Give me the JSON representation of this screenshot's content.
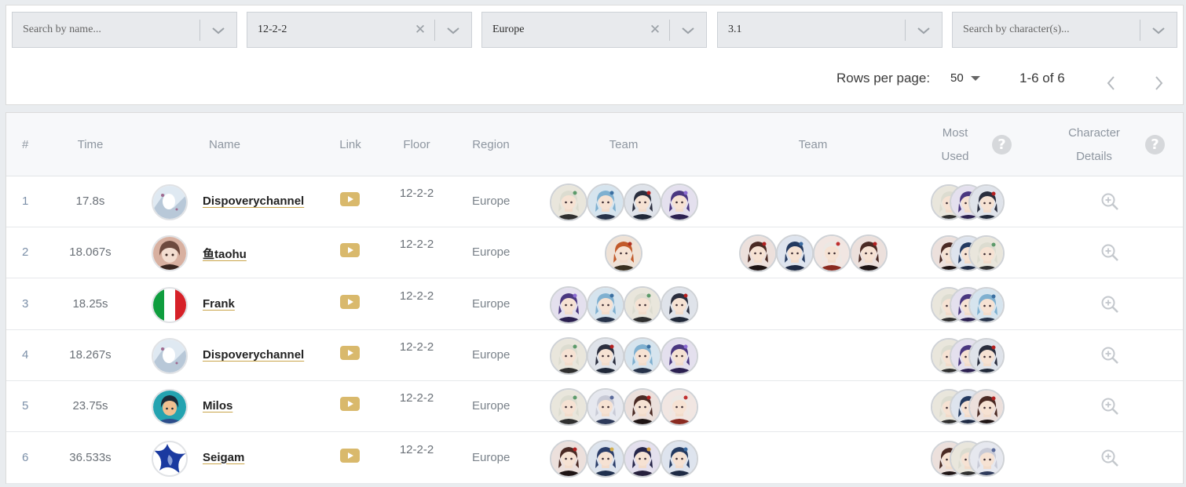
{
  "filters": [
    {
      "text": "Search by name...",
      "placeholder": true,
      "clearable": false
    },
    {
      "text": "12-2-2",
      "placeholder": false,
      "clearable": true
    },
    {
      "text": "Europe",
      "placeholder": false,
      "clearable": true
    },
    {
      "text": "3.1",
      "placeholder": false,
      "clearable": false
    },
    {
      "text": "Search by character(s)...",
      "placeholder": true,
      "clearable": false
    }
  ],
  "pagination": {
    "rows_per_page_label": "Rows per page:",
    "rows_per_page": "50",
    "range": "1-6 of 6"
  },
  "headers": {
    "rank": "#",
    "time": "Time",
    "name": "Name",
    "link": "Link",
    "floor": "Floor",
    "region": "Region",
    "team1": "Team",
    "team2": "Team",
    "most_used_1": "Most",
    "most_used_2": "Used",
    "details_1": "Character",
    "details_2": "Details"
  },
  "colors": {
    "accent_gold": "#c9a44a",
    "youtube": "#d9b96c",
    "header_bg": "#f7f8fa"
  },
  "characters": {
    "alhaitham": {
      "bg": "#e9e6dc",
      "hair": "#dcdcd0",
      "outfit": "#2f2f2f",
      "accent": "#5c9a6a"
    },
    "eula": {
      "bg": "#d6e4ee",
      "hair": "#7fb0d0",
      "outfit": "#27334a",
      "accent": "#3b6fa1"
    },
    "xiao": {
      "bg": "#dfe3ea",
      "hair": "#2a2e3e",
      "outfit": "#202838",
      "accent": "#b52020"
    },
    "raiden": {
      "bg": "#e4e0ee",
      "hair": "#4a3780",
      "outfit": "#2b2050",
      "accent": "#8a6ad0"
    },
    "tartaglia": {
      "bg": "#efe2d6",
      "hair": "#c25a2a",
      "outfit": "#3a3020",
      "accent": "#b03020"
    },
    "hutao": {
      "bg": "#ece0dc",
      "hair": "#4a2a24",
      "outfit": "#1e1414",
      "accent": "#b02020"
    },
    "yelan": {
      "bg": "#dee4ee",
      "hair": "#243a60",
      "outfit": "#1e2a44",
      "accent": "#3a6aa0"
    },
    "kazuha": {
      "bg": "#f1e6e2",
      "hair": "#ece8e4",
      "outfit": "#8a2a20",
      "accent": "#c03030"
    },
    "ayaka": {
      "bg": "#e6e8ef",
      "hair": "#c8cad6",
      "outfit": "#2e3a5a",
      "accent": "#5a6a9a"
    },
    "xingqiu": {
      "bg": "#dde4ee",
      "hair": "#2b3e6a",
      "outfit": "#20304e",
      "accent": "#d4b050"
    },
    "mona": {
      "bg": "#e4e0ee",
      "hair": "#27264a",
      "outfit": "#26203c",
      "accent": "#d4a040"
    }
  },
  "avatars": {
    "crystal": {
      "colors": [
        "#dfe9f2",
        "#b8c8d8",
        "#ffffff",
        "#a06a90"
      ]
    },
    "girl": {
      "colors": [
        "#6e4a3e",
        "#f3ddd0",
        "#3a2620",
        "#d8b0a0"
      ]
    },
    "italy": {
      "colors": [
        "#0f9d3e",
        "#ffffff",
        "#d62128"
      ]
    },
    "blueboy": {
      "colors": [
        "#24a3b0",
        "#1a2c3a",
        "#f0c090",
        "#2d4c8a"
      ]
    },
    "swirl": {
      "colors": [
        "#1a3aa0",
        "#ffffff",
        "#8aa0d8"
      ]
    }
  },
  "rows": [
    {
      "rank": "1",
      "time": "17.8s",
      "name": "Dispoverychannel",
      "floor": "12-2-2",
      "region": "Europe",
      "avatar": "crystal",
      "team1": [
        "alhaitham",
        "eula",
        "xiao",
        "raiden"
      ],
      "team2": [],
      "most_used": [
        "alhaitham",
        "raiden",
        "xiao"
      ]
    },
    {
      "rank": "2",
      "time": "18.067s",
      "name": "鱼taohu",
      "floor": "12-2-2",
      "region": "Europe",
      "avatar": "girl",
      "team1": [
        "tartaglia"
      ],
      "team2": [
        "hutao",
        "yelan",
        "kazuha",
        "hutao"
      ],
      "most_used": [
        "hutao",
        "yelan",
        "alhaitham"
      ]
    },
    {
      "rank": "3",
      "time": "18.25s",
      "name": "Frank",
      "floor": "12-2-2",
      "region": "Europe",
      "avatar": "italy",
      "team1": [
        "raiden",
        "eula",
        "alhaitham",
        "xiao"
      ],
      "team2": [],
      "most_used": [
        "alhaitham",
        "raiden",
        "eula"
      ]
    },
    {
      "rank": "4",
      "time": "18.267s",
      "name": "Dispoverychannel",
      "floor": "12-2-2",
      "region": "Europe",
      "avatar": "crystal",
      "team1": [
        "alhaitham",
        "xiao",
        "eula",
        "raiden"
      ],
      "team2": [],
      "most_used": [
        "alhaitham",
        "raiden",
        "xiao"
      ]
    },
    {
      "rank": "5",
      "time": "23.75s",
      "name": "Milos",
      "floor": "12-2-2",
      "region": "Europe",
      "avatar": "blueboy",
      "team1": [
        "alhaitham",
        "ayaka",
        "hutao",
        "kazuha"
      ],
      "team2": [],
      "most_used": [
        "alhaitham",
        "yelan",
        "hutao"
      ]
    },
    {
      "rank": "6",
      "time": "36.533s",
      "name": "Seigam",
      "floor": "12-2-2",
      "region": "Europe",
      "avatar": "swirl",
      "team1": [
        "hutao",
        "xingqiu",
        "mona",
        "yelan"
      ],
      "team2": [],
      "most_used": [
        "hutao",
        "alhaitham",
        "ayaka"
      ]
    }
  ]
}
